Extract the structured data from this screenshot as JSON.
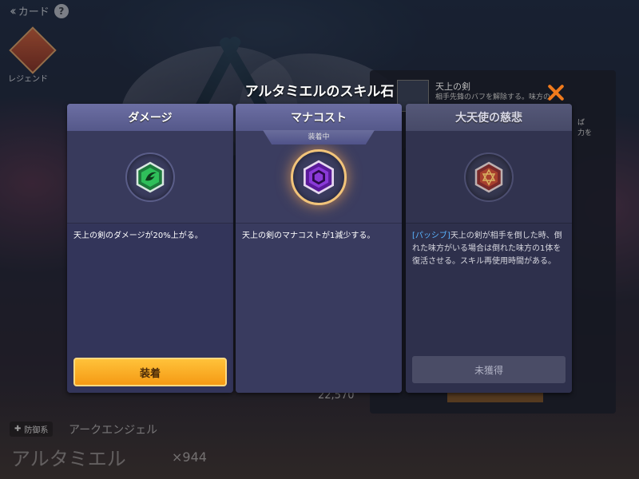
{
  "topbar": {
    "back_icon": "back-chevron-icon",
    "title": "カード",
    "help": "?"
  },
  "legend": {
    "label": "レジェンド"
  },
  "back_panel": {
    "title": "天上の剣",
    "desc": "相手先鋒のバフを解除する。味方の",
    "side_line1": "ば",
    "side_line2": "力を",
    "damage_value": "22,570"
  },
  "character": {
    "type_tag": "防御系",
    "class_name": "アークエンジェル",
    "name": "アルタミエル",
    "count": "×944"
  },
  "modal": {
    "title": "アルタミエルのスキル石",
    "close_icon": "close-x-icon",
    "cards": [
      {
        "header": "ダメージ",
        "gem": "green-gem-icon",
        "gem_color": "#2fbf5a",
        "description": "天上の剣のダメージが20%上がる。",
        "button": "装着"
      },
      {
        "header": "マナコスト",
        "equipped_tag": "装着中",
        "gem": "purple-gem-icon",
        "gem_color": "#8a3ad8",
        "description": "天上の剣のマナコストが1減少する。"
      },
      {
        "header": "大天使の慈悲",
        "gem": "red-star-gem-icon",
        "gem_color": "#c0392b",
        "passive_label": "[パッシブ]",
        "description": "天上の剣が相手を倒した時、倒れた味方がいる場合は倒れた味方の1体を復活させる。スキル再使用時間がある。",
        "button": "未獲得"
      }
    ]
  }
}
